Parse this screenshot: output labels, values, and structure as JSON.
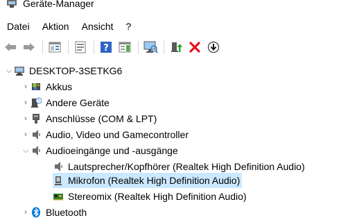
{
  "window": {
    "title": "Geräte-Manager"
  },
  "menu": [
    {
      "label": "Datei"
    },
    {
      "label": "Aktion"
    },
    {
      "label": "Ansicht"
    },
    {
      "label": "?"
    }
  ],
  "toolbar": {
    "icons": [
      "back-arrow-icon",
      "forward-arrow-icon",
      "properties-icon",
      "show-hidden-icon",
      "help-icon",
      "action-pane-icon",
      "scan-hardware-icon",
      "update-driver-icon",
      "uninstall-device-icon",
      "disable-device-icon"
    ]
  },
  "tree": {
    "root": {
      "label": "DESKTOP-3SETKG6",
      "expanded": true
    },
    "categories": [
      {
        "label": "Akkus",
        "expanded": false
      },
      {
        "label": "Andere Geräte",
        "expanded": false
      },
      {
        "label": "Anschlüsse (COM & LPT)",
        "expanded": false
      },
      {
        "label": "Audio, Video und Gamecontroller",
        "expanded": false
      },
      {
        "label": "Audioeingänge und -ausgänge",
        "expanded": true,
        "children": [
          {
            "label": "Lautsprecher/Kopfhörer (Realtek High Definition Audio)",
            "selected": false
          },
          {
            "label": "Mikrofon (Realtek High Definition Audio)",
            "selected": true
          },
          {
            "label": "Stereomix (Realtek High Definition Audio)",
            "selected": false
          }
        ]
      },
      {
        "label": "Bluetooth",
        "expanded": false
      }
    ]
  },
  "colors": {
    "selection": "#cce8ff",
    "uninstall_red": "#e81123",
    "bluetooth_blue": "#0078d7",
    "help_blue": "#2f63c8"
  }
}
